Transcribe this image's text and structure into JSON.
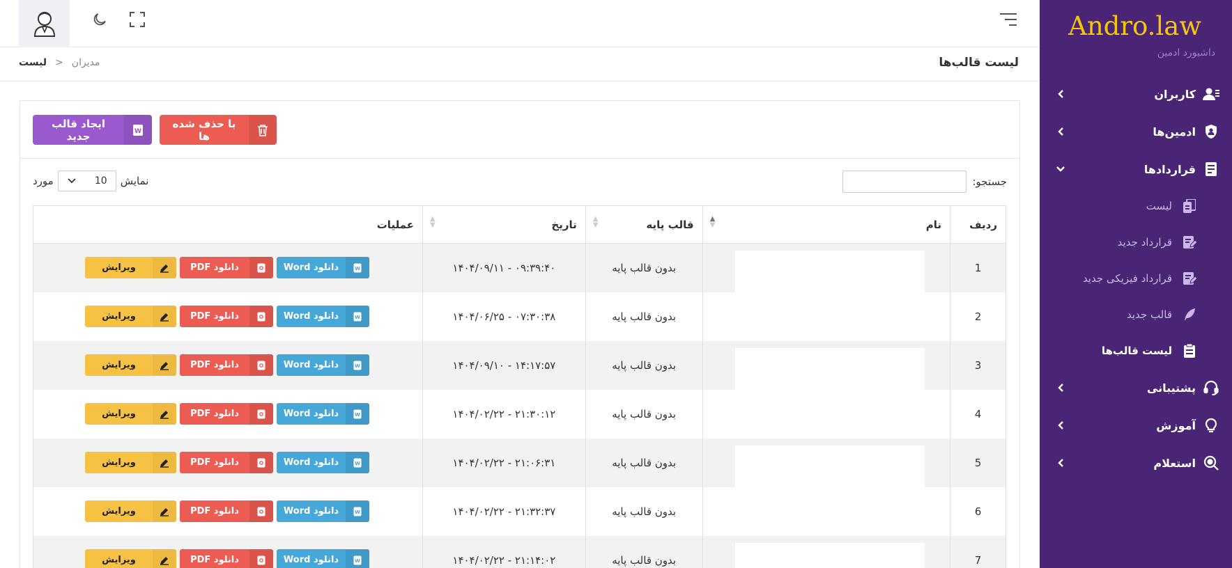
{
  "brand": {
    "logo": "Andro.law",
    "subtitle": "داشبورد ادمین"
  },
  "sidebar": {
    "items": [
      {
        "label": "کاربران",
        "icon": "user-list-icon"
      },
      {
        "label": "ادمین‌ها",
        "icon": "shield-user-icon"
      },
      {
        "label": "قراردادها",
        "icon": "contract-icon",
        "expanded": true
      }
    ],
    "sub_items": [
      {
        "label": "لیست",
        "icon": "copy-icon"
      },
      {
        "label": "قرارداد جدید",
        "icon": "edit-doc-icon"
      },
      {
        "label": "قرارداد فیزیکی جدید",
        "icon": "edit-doc-icon"
      },
      {
        "label": "قالب جدید",
        "icon": "feather-icon"
      },
      {
        "label": "لیست قالب‌ها",
        "icon": "clipboard-icon",
        "active": true
      }
    ],
    "items_after": [
      {
        "label": "پشتیبانی",
        "icon": "headset-icon"
      },
      {
        "label": "آموزش",
        "icon": "bulb-icon"
      },
      {
        "label": "استعلام",
        "icon": "search-circle-icon"
      }
    ]
  },
  "header": {
    "title": "لیست قالب‌ها"
  },
  "breadcrumb": {
    "parent": "مدیران",
    "sep": "<",
    "current": "لیست"
  },
  "toolbar": {
    "create_label": "ایجاد قالب جدید",
    "deleted_label": "با حذف شده ها"
  },
  "controls": {
    "search_label": "جستجو:",
    "show_label": "نمایش",
    "page_size": "10",
    "items_label": "مورد"
  },
  "table": {
    "columns": [
      "ردیف",
      "نام",
      "قالب پایه",
      "تاریخ",
      "عملیات"
    ],
    "rows": [
      {
        "index": "1",
        "name": "",
        "base": "بدون قالب پایه",
        "date": "۱۴۰۴/۰۹/۱۱ - ۰۹:۳۹:۴۰"
      },
      {
        "index": "2",
        "name": "",
        "base": "بدون قالب پایه",
        "date": "۱۴۰۴/۰۶/۲۵ - ۰۷:۳۰:۳۸"
      },
      {
        "index": "3",
        "name": "",
        "base": "بدون قالب پایه",
        "date": "۱۴۰۴/۰۹/۱۰ - ۱۴:۱۷:۵۷"
      },
      {
        "index": "4",
        "name": "",
        "base": "بدون قالب پایه",
        "date": "۱۴۰۴/۰۲/۲۲ - ۲۱:۳۰:۱۲"
      },
      {
        "index": "5",
        "name": "",
        "base": "بدون قالب پایه",
        "date": "۱۴۰۴/۰۲/۲۲ - ۲۱:۰۶:۳۱"
      },
      {
        "index": "6",
        "name": "",
        "base": "بدون قالب پایه",
        "date": "۱۴۰۴/۰۲/۲۲ - ۲۱:۳۲:۳۷"
      },
      {
        "index": "7",
        "name": "",
        "base": "بدون قالب پایه",
        "date": "۱۴۰۴/۰۲/۲۲ - ۲۱:۱۴:۰۲"
      }
    ],
    "actions": {
      "word": "دانلود Word",
      "pdf": "دانلود PDF",
      "edit": "ویرایش"
    }
  },
  "colors": {
    "sidebar": "#4a2575",
    "brand": "#f4c70c",
    "purple_btn": "#9b59d0",
    "red_btn": "#ed5c52",
    "blue_btn": "#45a8d8",
    "yellow_btn": "#f7c143"
  }
}
